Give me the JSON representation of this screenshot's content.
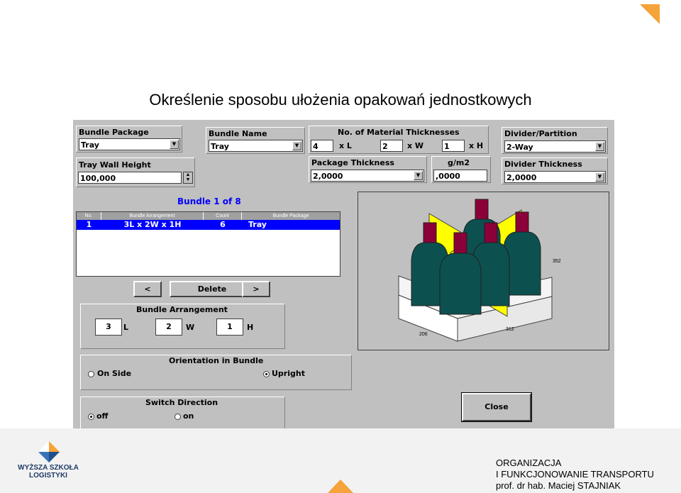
{
  "slide": {
    "title": "Określenie sposobu ułożenia opakowań jednostkowych",
    "footer_line1": "ORGANIZACJA",
    "footer_line2": "I FUNKCJONOWANIE TRANSPORTU",
    "footer_line3": "prof. dr hab. Maciej STAJNIAK",
    "logo_line1": "WYŻSZA SZKOŁA",
    "logo_line2": "LOGISTYKI",
    "accent_color": "#f5a33a"
  },
  "form": {
    "bundle_package": {
      "label": "Bundle Package",
      "value": "Tray"
    },
    "bundle_name": {
      "label": "Bundle Name",
      "value": "Tray"
    },
    "material": {
      "label": "No. of Material Thicknesses",
      "l_value": "4",
      "l_unit": "x L",
      "w_value": "2",
      "w_unit": "x W",
      "h_value": "1",
      "h_unit": "x H"
    },
    "divider": {
      "label": "Divider/Partition",
      "value": "2-Way"
    },
    "tray_wall": {
      "label": "Tray Wall Height",
      "value": "100,000"
    },
    "package_thickness": {
      "label": "Package Thickness",
      "value": "2,0000"
    },
    "gm2": {
      "label": "g/m2",
      "value": ",0000"
    },
    "divider_thickness": {
      "label": "Divider Thickness",
      "value": "2,0000"
    }
  },
  "list": {
    "title": "Bundle  1 of 8",
    "columns": [
      "No.",
      "Bundle Arrangement",
      "Count",
      "Bundle Package"
    ],
    "row": {
      "no": "1",
      "arrangement": "3L x  2W x  1H",
      "count": "6",
      "package": "Tray"
    }
  },
  "nav": {
    "prev": "<",
    "delete": "Delete",
    "next": ">"
  },
  "arrangement": {
    "label": "Bundle Arrangement",
    "l_value": "3",
    "l_unit": "L",
    "w_value": "2",
    "w_unit": "W",
    "h_value": "1",
    "h_unit": "H"
  },
  "orientation": {
    "label": "Orientation in Bundle",
    "option1": "On Side",
    "option2": "Upright",
    "selected": "Upright"
  },
  "switch": {
    "label": "Switch Direction",
    "option1": "off",
    "option2": "on",
    "selected": "off"
  },
  "close_label": "Close",
  "preview": {
    "dim_height": "352",
    "dim_length": "312",
    "dim_width": "206"
  }
}
